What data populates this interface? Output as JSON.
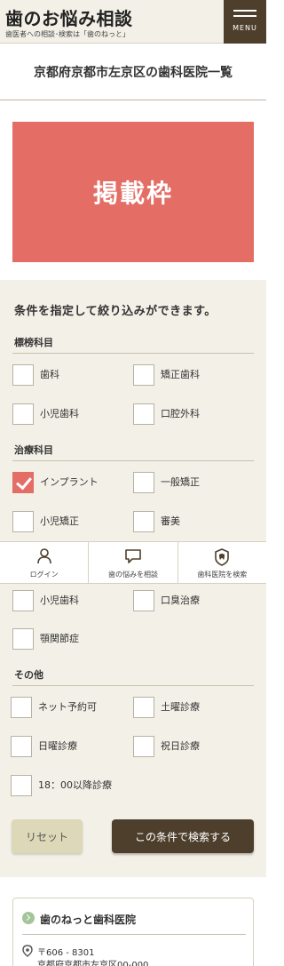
{
  "header": {
    "site_title": "歯のお悩み相談",
    "site_subtitle": "歯医者への相談･検索は「歯のねっと」",
    "menu_label": "MENU"
  },
  "page_title": "京都府京都市左京区の歯科医院一覧",
  "ad_banner": "掲載枠",
  "filter": {
    "lead": "条件を指定して絞り込みができます。",
    "groups": [
      {
        "title": "標榜科目",
        "options": [
          {
            "label": "歯科",
            "checked": false
          },
          {
            "label": "矯正歯科",
            "checked": false
          },
          {
            "label": "小児歯科",
            "checked": false
          },
          {
            "label": "口腔外科",
            "checked": false
          }
        ]
      },
      {
        "title": "治療科目",
        "options": [
          {
            "label": "インプラント",
            "checked": true
          },
          {
            "label": "一般矯正",
            "checked": false
          },
          {
            "label": "小児矯正",
            "checked": false
          },
          {
            "label": "審美",
            "checked": false
          },
          {
            "label": "小児歯科",
            "checked": false
          },
          {
            "label": "口臭治療",
            "checked": false
          },
          {
            "label": "顎関節症",
            "checked": false
          }
        ]
      },
      {
        "title": "その他",
        "options": [
          {
            "label": "ネット予約可",
            "checked": false
          },
          {
            "label": "土曜診療",
            "checked": false
          },
          {
            "label": "日曜診療",
            "checked": false
          },
          {
            "label": "祝日診療",
            "checked": false
          },
          {
            "label": "18：00以降診療",
            "checked": false
          }
        ]
      }
    ],
    "reset_label": "リセット",
    "search_label": "この条件で検索する"
  },
  "bottom_nav": [
    {
      "label": "ログイン",
      "icon": "user-icon"
    },
    {
      "label": "歯の悩みを相談",
      "icon": "chat-bubble-icon"
    },
    {
      "label": "歯科医院を検索",
      "icon": "tooth-badge-icon"
    }
  ],
  "clinic_card": {
    "name": "歯のねっと歯科医院",
    "zip": "〒606 - 8301",
    "address": "京都府京都市左京区00-000"
  },
  "colors": {
    "accent": "#e46d66",
    "dark_brown": "#4e3f2c",
    "beige_bg": "#f3f0e7",
    "reset_bg": "#dcd8b8",
    "card_arrow": "#a4c59b"
  }
}
